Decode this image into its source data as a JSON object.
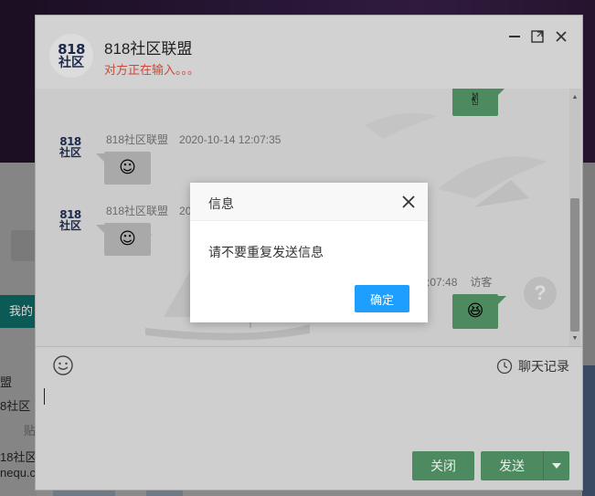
{
  "background": {
    "green_button_label": "我的",
    "text_1": "盟",
    "text_2": "8社区",
    "text_3": "贴",
    "text_4": "18社区",
    "text_5": "nequ.c"
  },
  "chat": {
    "title": "818社区联盟",
    "status": "对方正在输入。。。",
    "logo_top": "818",
    "logo_bottom": "社区",
    "messages": [
      {
        "sender": "818社区联盟",
        "time": "2020-10-14 12:07:35",
        "emoji": "☺"
      },
      {
        "sender": "818社区联盟",
        "time": "20",
        "emoji": "☺"
      }
    ],
    "top_bubble_emoji": "✌",
    "visitor": {
      "time": ":07:48",
      "label": "访客",
      "emoji": "😆"
    },
    "history_label": "聊天记录",
    "close_label": "关闭",
    "send_label": "发送"
  },
  "dialog": {
    "title": "信息",
    "message": "请不要重复发送信息",
    "ok_label": "确定"
  },
  "colors": {
    "accent_green": "#4e8a5f",
    "dialog_blue": "#1e9fff",
    "status_red": "#c84a3a"
  }
}
